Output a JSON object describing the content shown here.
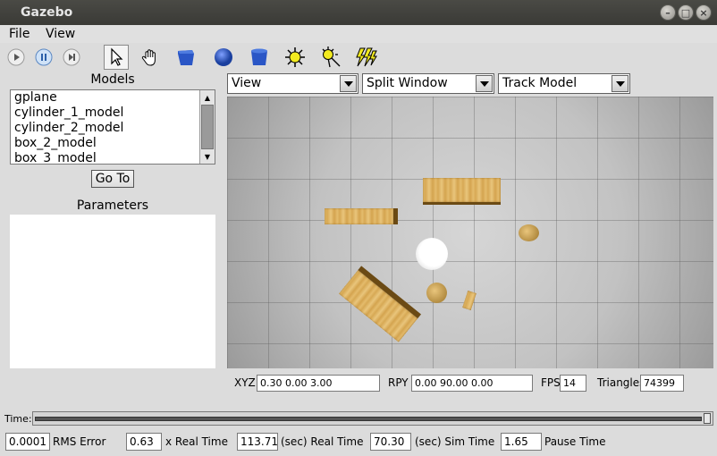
{
  "window": {
    "title": "Gazebo"
  },
  "menu": {
    "file": "File",
    "view": "View"
  },
  "toolbar": {
    "icons": [
      "play-icon",
      "pause-icon",
      "step-icon",
      "cursor-icon",
      "hand-icon",
      "box-icon",
      "sphere-icon",
      "cylinder-icon",
      "point-light-icon",
      "spot-light-icon",
      "directional-light-icon"
    ]
  },
  "left": {
    "models_label": "Models",
    "models": [
      "gplane",
      "cylinder_1_model",
      "cylinder_2_model",
      "box_2_model",
      "box_3_model"
    ],
    "goto_label": "Go To",
    "parameters_label": "Parameters"
  },
  "view_controls": {
    "view_select": "View",
    "split_select": "Split Window",
    "track_select": "Track Model"
  },
  "viewport_status": {
    "xyz_label": "XYZ",
    "xyz_value": "0.30  0.00  3.00",
    "rpy_label": "RPY",
    "rpy_value": "0.00  90.00  0.00",
    "fps_label": "FPS",
    "fps_value": "14",
    "triangles_label": "Triangles",
    "triangles_value": "74399"
  },
  "time": {
    "label": "Time:",
    "position": 1.0
  },
  "stats": {
    "rms_value": "0.0001",
    "rms_label": "RMS Error",
    "factor_value": "0.63",
    "factor_label": "x Real Time",
    "real_value": "113.71",
    "real_label": "(sec) Real Time",
    "sim_value": "70.30",
    "sim_label": "(sec) Sim Time",
    "pause_value": "1.65",
    "pause_label": "Pause Time"
  }
}
